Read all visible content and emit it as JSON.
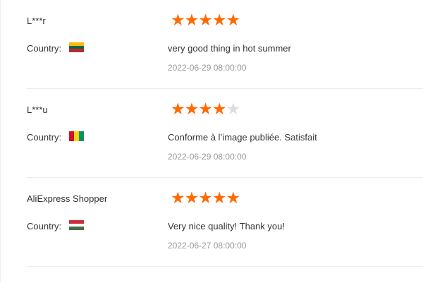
{
  "country_label": "Country:",
  "colors": {
    "star_on": "#ff6a00",
    "star_off": "#dddddd"
  },
  "reviews": [
    {
      "user": "L***r",
      "country_label": "Country:",
      "flag": {
        "name": "lithuania-flag-icon",
        "stripes": [
          "#fdb913",
          "#006a44",
          "#c1272d"
        ]
      },
      "rating": 5,
      "text": "very good thing in hot summer",
      "date": "2022-06-29 08:00:00"
    },
    {
      "user": "L***u",
      "country_label": "Country:",
      "flag": {
        "name": "guinea-flag-icon",
        "stripes": [
          "#ce1126",
          "#fcd116",
          "#009460"
        ]
      },
      "rating": 4,
      "text": "Conforme à l’image publiée. Satisfait",
      "date": "2022-06-29 08:00:00"
    },
    {
      "user": "AliExpress Shopper",
      "country_label": "Country:",
      "flag": {
        "name": "hungary-flag-icon",
        "stripes": [
          "#cd2a3e",
          "#ffffff",
          "#436f4d"
        ]
      },
      "rating": 5,
      "text": "Very nice quality! Thank you!",
      "date": "2022-06-27 08:00:00"
    }
  ]
}
